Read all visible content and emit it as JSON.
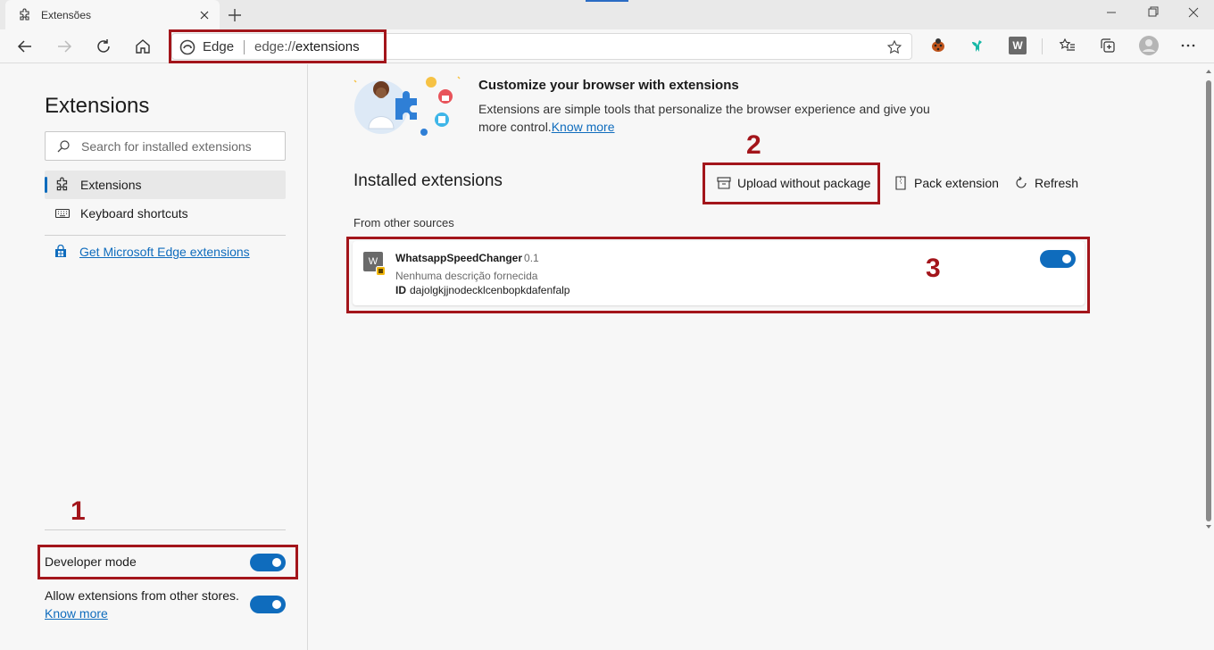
{
  "tab": {
    "title": "Extensões"
  },
  "omnibox": {
    "brand": "Edge",
    "url_scheme": "edge://",
    "url_path": "extensions"
  },
  "toolbar_extensions": {
    "w_badge": "W"
  },
  "sidebar": {
    "title": "Extensions",
    "search_placeholder": "Search for installed extensions",
    "items": [
      {
        "label": "Extensions",
        "icon": "puzzle-icon",
        "selected": true
      },
      {
        "label": "Keyboard shortcuts",
        "icon": "keyboard-icon",
        "selected": false
      }
    ],
    "get_extensions_link": "Get Microsoft Edge extensions",
    "developer_mode": {
      "label": "Developer mode",
      "enabled": true
    },
    "allow_other_stores": {
      "label": "Allow extensions from other stores.",
      "link": "Know more",
      "enabled": true
    }
  },
  "banner": {
    "title": "Customize your browser with extensions",
    "description": "Extensions are simple tools that personalize the browser experience and give you more control.",
    "link": "Know more"
  },
  "installed": {
    "title": "Installed extensions",
    "actions": {
      "upload": "Upload without package",
      "pack": "Pack extension",
      "refresh": "Refresh"
    },
    "section_label": "From other sources",
    "extension": {
      "icon_letter": "W",
      "name": "WhatsappSpeedChanger",
      "version": "0.1",
      "description": "Nenhuma descrição fornecida",
      "id_label": "ID",
      "id": "dajolgkjjnodecklcenbopkdafenfalp",
      "enabled": true
    }
  },
  "annotations": [
    "1",
    "2",
    "3"
  ],
  "colors": {
    "accent": "#0f6cbd",
    "annotation_red": "#a3151b"
  }
}
